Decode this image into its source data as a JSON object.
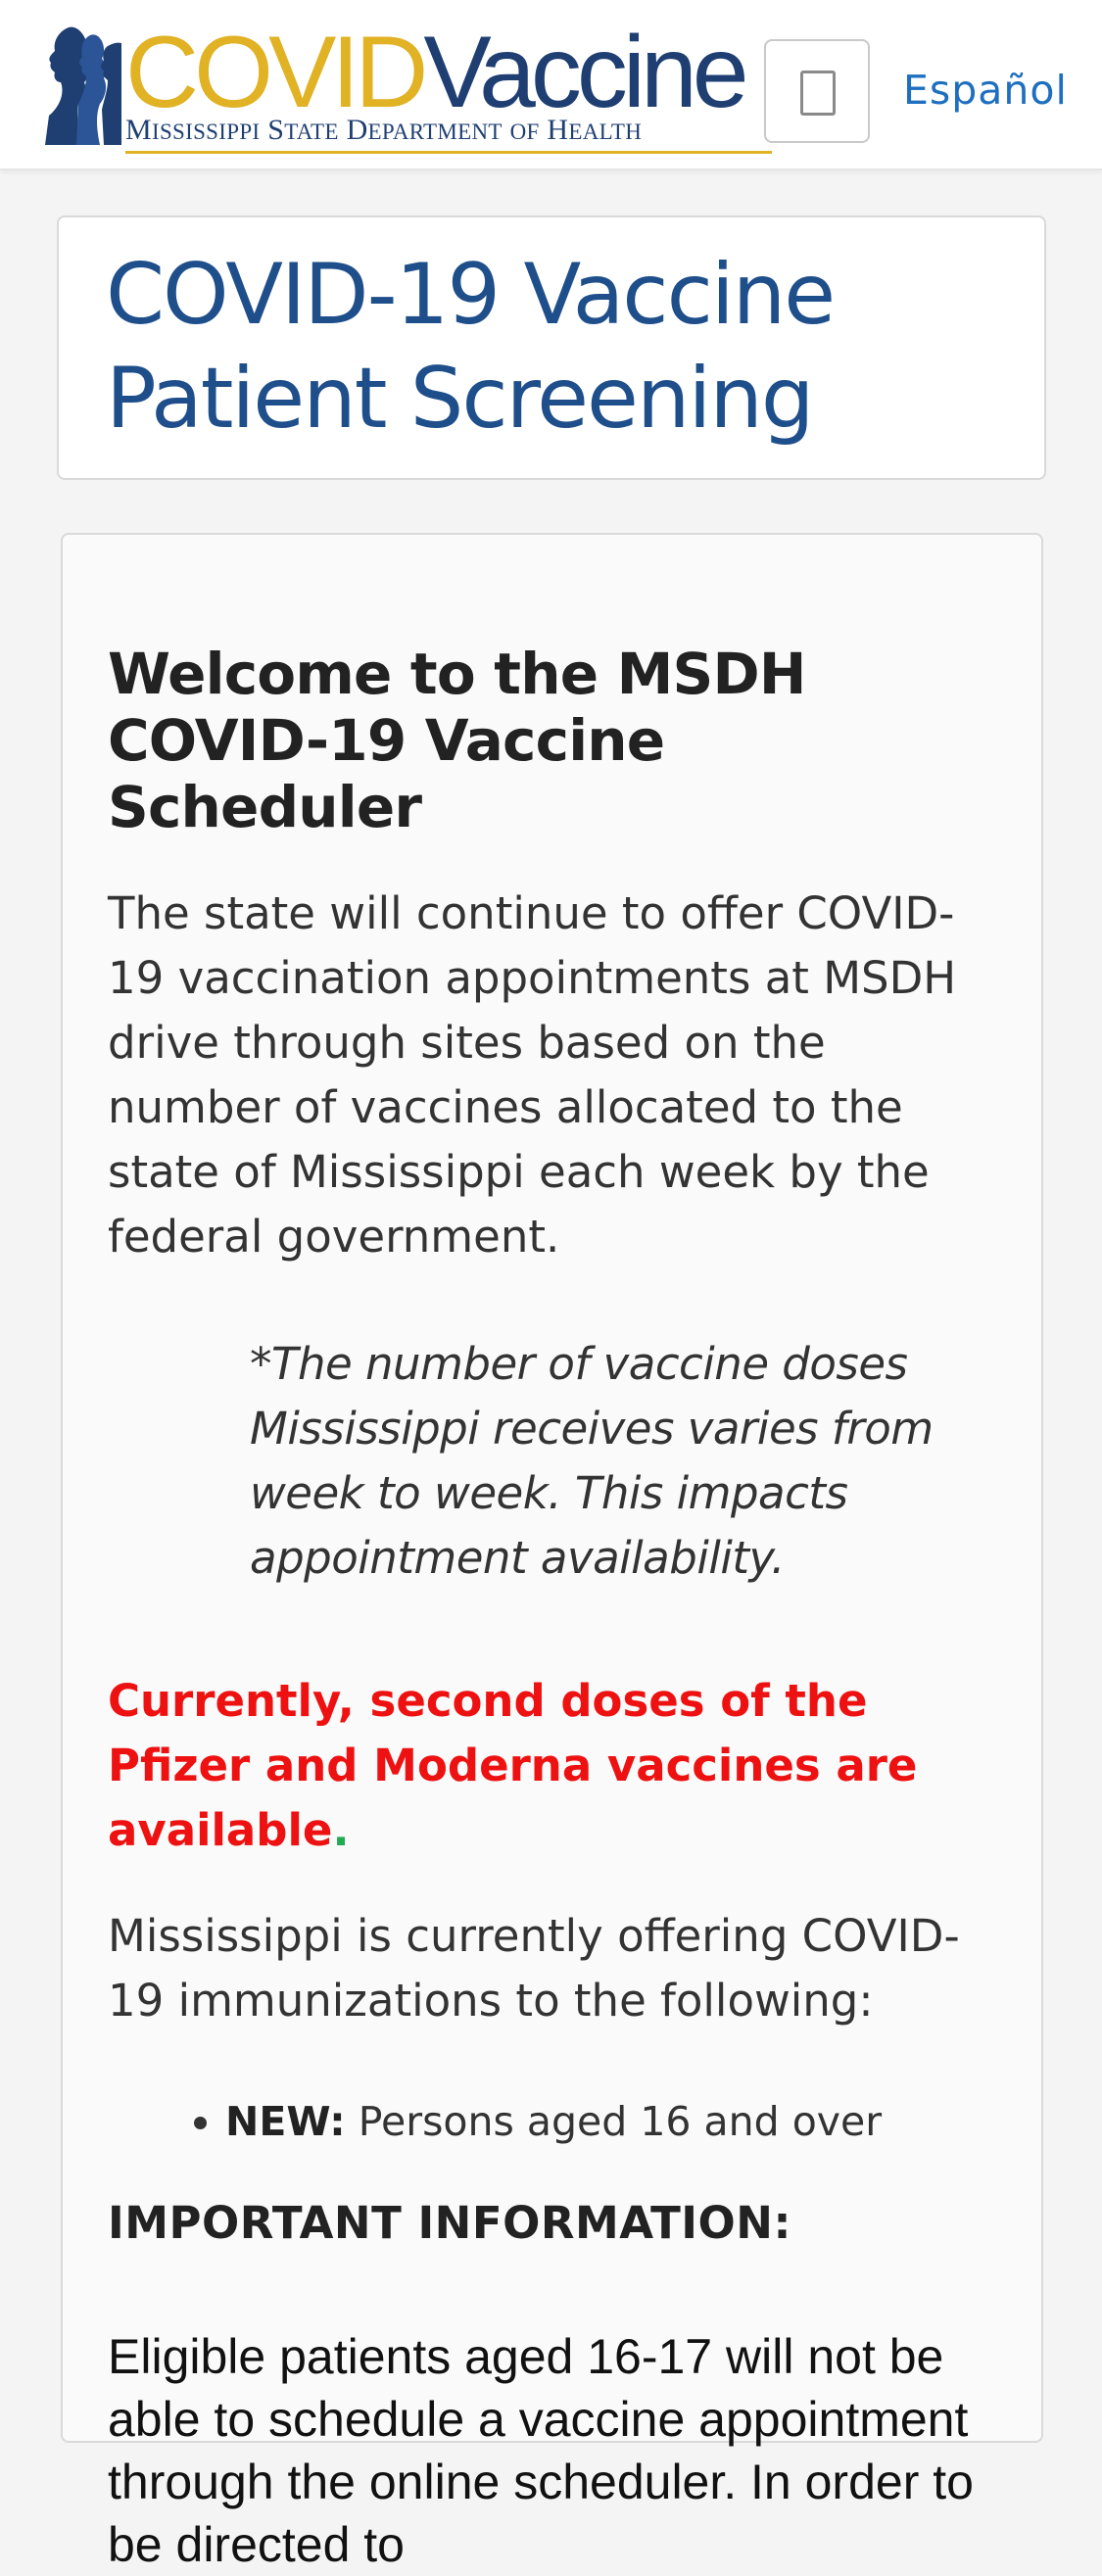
{
  "header": {
    "logo_covid": "COVID",
    "logo_vaccine": "Vaccine",
    "logo_subtitle_parts": [
      {
        "cap": "M",
        "rest": "ISSISSIPPI"
      },
      {
        "cap": "S",
        "rest": "TATE"
      },
      {
        "cap": "D",
        "rest": "EPARTMENT"
      },
      {
        "cap": "",
        "rest": "OF"
      },
      {
        "cap": "H",
        "rest": "EALTH"
      }
    ],
    "language_link": "Español"
  },
  "title_card": {
    "title": "COVID-19 Vaccine Patient Screening"
  },
  "content": {
    "welcome_heading": "Welcome to the MSDH COVID-19 Vaccine Scheduler",
    "intro_paragraph": "The state will continue to offer COVID-19 vaccination appointments at MSDH drive through sites based on the number of vaccines allocated to the state of Mississippi each week by the federal government.",
    "note": "*The number of vaccine doses Mississippi receives varies from week to week.  This impacts appointment availability.",
    "alert": "Currently, second doses of the Pfizer and Moderna vaccines are available",
    "alert_period": ".",
    "offer_intro": "Mississippi is currently offering COVID-19 immunizations to the following:",
    "eligibility": [
      {
        "label": "NEW:",
        "text": " Persons aged 16 and over"
      }
    ],
    "important_heading": "IMPORTANT INFORMATION:",
    "eligible_paragraph": "Eligible patients aged 16-17 will not be able to schedule a vaccine appointment through the online scheduler. In order to be directed to"
  },
  "colors": {
    "brand_gold": "#e0b224",
    "brand_navy": "#1f3f73",
    "title_blue": "#1f4f8b",
    "link_blue": "#1e6fbf",
    "alert_red": "#ee1111",
    "alert_dot_green": "#22aa55"
  }
}
